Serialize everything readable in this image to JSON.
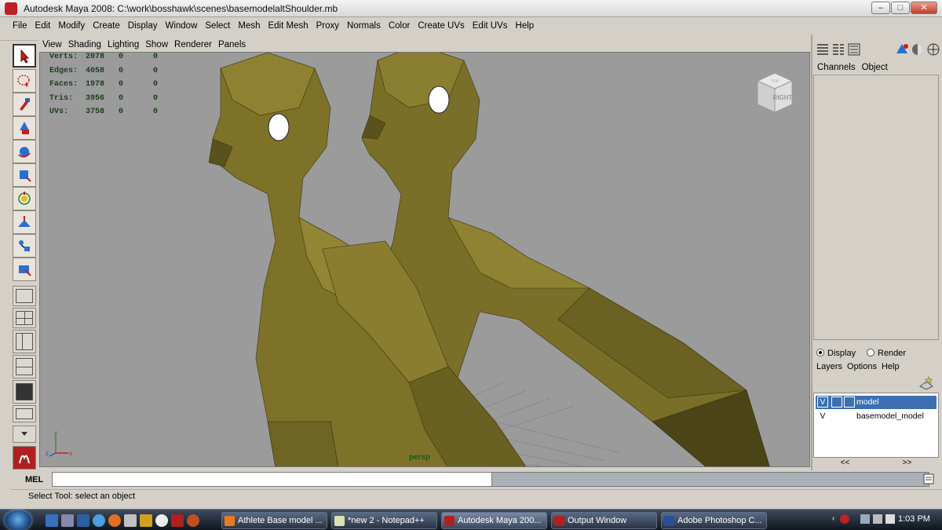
{
  "window": {
    "title": "Autodesk Maya 2008: C:\\work\\bosshawk\\scenes\\basemodelaltShoulder.mb",
    "minimize": "–",
    "maximize": "□",
    "close": "✕"
  },
  "menubar": [
    "File",
    "Edit",
    "Modify",
    "Create",
    "Display",
    "Window",
    "Select",
    "Mesh",
    "Edit Mesh",
    "Proxy",
    "Normals",
    "Color",
    "Create UVs",
    "Edit UVs",
    "Help"
  ],
  "panel_menu": [
    "View",
    "Shading",
    "Lighting",
    "Show",
    "Renderer",
    "Panels"
  ],
  "hud": {
    "rows": [
      {
        "label": "Verts:",
        "v1": "2078",
        "v2": "0",
        "v3": "0"
      },
      {
        "label": "Edges:",
        "v1": "4058",
        "v2": "0",
        "v3": "0"
      },
      {
        "label": "Faces:",
        "v1": "1978",
        "v2": "0",
        "v3": "0"
      },
      {
        "label": "Tris:",
        "v1": "3956",
        "v2": "0",
        "v3": "0"
      },
      {
        "label": "UVs:",
        "v1": "3758",
        "v2": "0",
        "v3": "0"
      }
    ]
  },
  "viewcube": {
    "face": "RIGHT",
    "top": "TOP"
  },
  "camera_label": "persp",
  "axis": {
    "y": "y",
    "z": "z",
    "x": "x"
  },
  "channel_box": {
    "tabs": [
      "Channels",
      "Object"
    ]
  },
  "layer_editor": {
    "mode_display": "Display",
    "mode_render": "Render",
    "menus": [
      "Layers",
      "Options",
      "Help"
    ],
    "layers": [
      {
        "visible": "V",
        "name": "model",
        "selected": true
      },
      {
        "visible": "V",
        "name": "basemodel_model",
        "selected": false
      }
    ],
    "nav_left": "<<",
    "nav_right": ">>"
  },
  "command_line": {
    "label": "MEL",
    "value": ""
  },
  "help_line": "Select Tool: select an object",
  "taskbar": {
    "tasks": [
      {
        "label": "Athlete Base model ...",
        "color": "#e87a1c"
      },
      {
        "label": "*new  2 - Notepad++",
        "color": "#d8e4b0"
      },
      {
        "label": "Autodesk Maya 200...",
        "color": "#b02020",
        "active": true
      },
      {
        "label": "Output Window",
        "color": "#b02020"
      },
      {
        "label": "Adobe Photoshop C...",
        "color": "#2a4f9a"
      }
    ],
    "clock": "1:03 PM"
  },
  "colors": {
    "viewport_bg": "#9b9b9b",
    "model": "#7a6f28",
    "hud_text": "#1c3d1c",
    "layer_selected": "#3c6fb0"
  },
  "icons": [
    "select-tool-icon",
    "lasso-tool-icon",
    "paint-select-icon",
    "move-tool-icon",
    "rotate-tool-icon",
    "scale-tool-icon",
    "manipulator-icon",
    "soft-mod-icon",
    "show-manipulator-icon",
    "last-tool-icon"
  ]
}
